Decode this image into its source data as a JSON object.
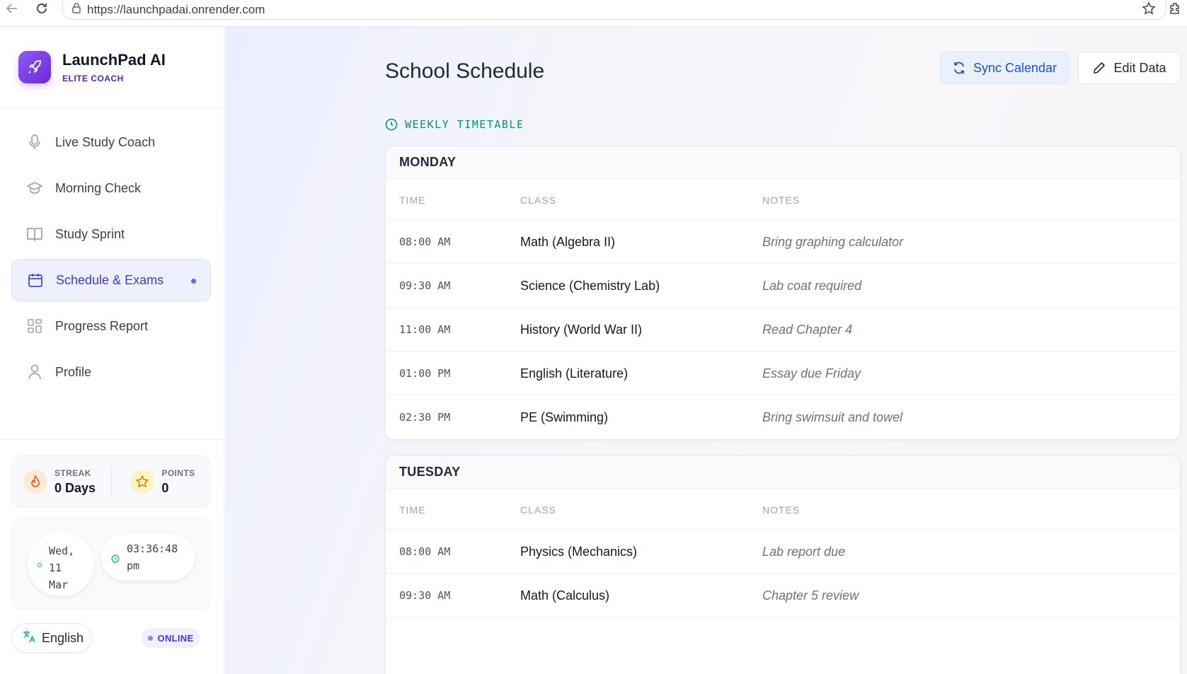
{
  "browser": {
    "url": "https://launchpadai.onrender.com"
  },
  "brand": {
    "title": "LaunchPad AI",
    "subtitle": "ELITE COACH",
    "accent": "#7c3aed"
  },
  "nav": {
    "items": [
      {
        "label": "Live Study Coach",
        "icon": "microphone-icon"
      },
      {
        "label": "Morning Check",
        "icon": "graduation-cap-icon"
      },
      {
        "label": "Study Sprint",
        "icon": "book-icon"
      },
      {
        "label": "Schedule & Exams",
        "icon": "calendar-icon",
        "active": true
      },
      {
        "label": "Progress Report",
        "icon": "grid-icon"
      },
      {
        "label": "Profile",
        "icon": "user-icon"
      }
    ]
  },
  "stats": {
    "streak_label": "STREAK",
    "streak_value": "0 Days",
    "points_label": "POINTS",
    "points_value": "0"
  },
  "clock": {
    "date_line1": "Wed,",
    "date_line2": "11",
    "date_line3": "Mar",
    "time_line1": "03:36:48",
    "time_line2": "pm"
  },
  "footer": {
    "language": "English",
    "status": "ONLINE"
  },
  "main": {
    "title": "School Schedule",
    "sync_label": "Sync Calendar",
    "edit_label": "Edit Data",
    "section_label": "WEEKLY TIMETABLE",
    "columns": {
      "time": "TIME",
      "class": "CLASS",
      "notes": "NOTES"
    },
    "days": [
      {
        "name": "MONDAY",
        "rows": [
          {
            "time": "08:00 AM",
            "class": "Math (Algebra II)",
            "notes": "Bring graphing calculator"
          },
          {
            "time": "09:30 AM",
            "class": "Science (Chemistry Lab)",
            "notes": "Lab coat required"
          },
          {
            "time": "11:00 AM",
            "class": "History (World War II)",
            "notes": "Read Chapter 4"
          },
          {
            "time": "01:00 PM",
            "class": "English (Literature)",
            "notes": "Essay due Friday"
          },
          {
            "time": "02:30 PM",
            "class": "PE (Swimming)",
            "notes": "Bring swimsuit and towel"
          }
        ]
      },
      {
        "name": "TUESDAY",
        "rows": [
          {
            "time": "08:00 AM",
            "class": "Physics (Mechanics)",
            "notes": "Lab report due"
          },
          {
            "time": "09:30 AM",
            "class": "Math (Calculus)",
            "notes": "Chapter 5 review"
          }
        ]
      }
    ]
  }
}
